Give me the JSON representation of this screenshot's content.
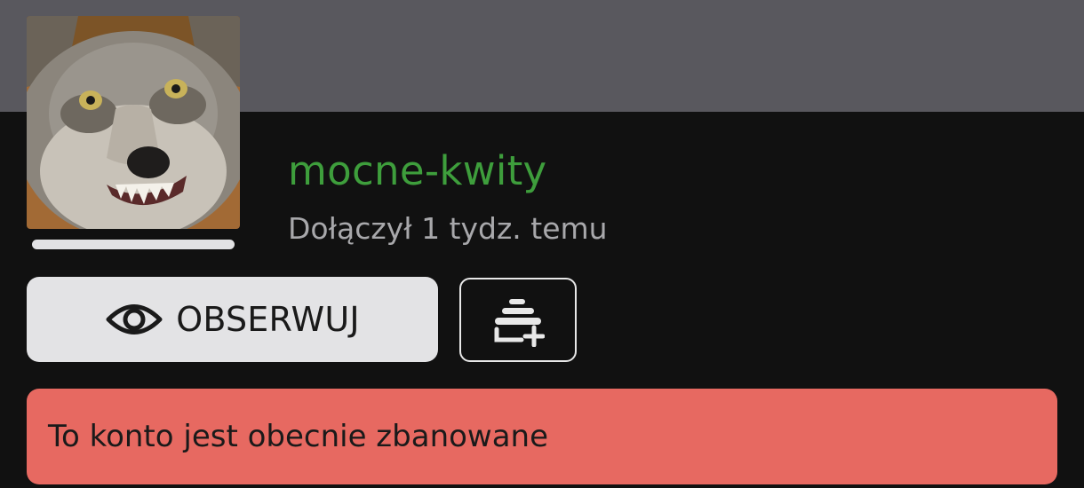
{
  "profile": {
    "username": "mocne-kwity",
    "joined": "Dołączył 1 tydz. temu",
    "avatar_icon": "wolf-avatar",
    "level_progress": 1.0
  },
  "actions": {
    "follow_label": "OBSERWUJ",
    "follow_icon": "eye-icon",
    "collection_icon": "add-to-collection-icon"
  },
  "notice": {
    "ban_text": "To konto jest obecnie zbanowane"
  },
  "colors": {
    "banner": "#59585e",
    "background": "#111111",
    "username": "#3e9e3c",
    "notice": "#e76961"
  }
}
